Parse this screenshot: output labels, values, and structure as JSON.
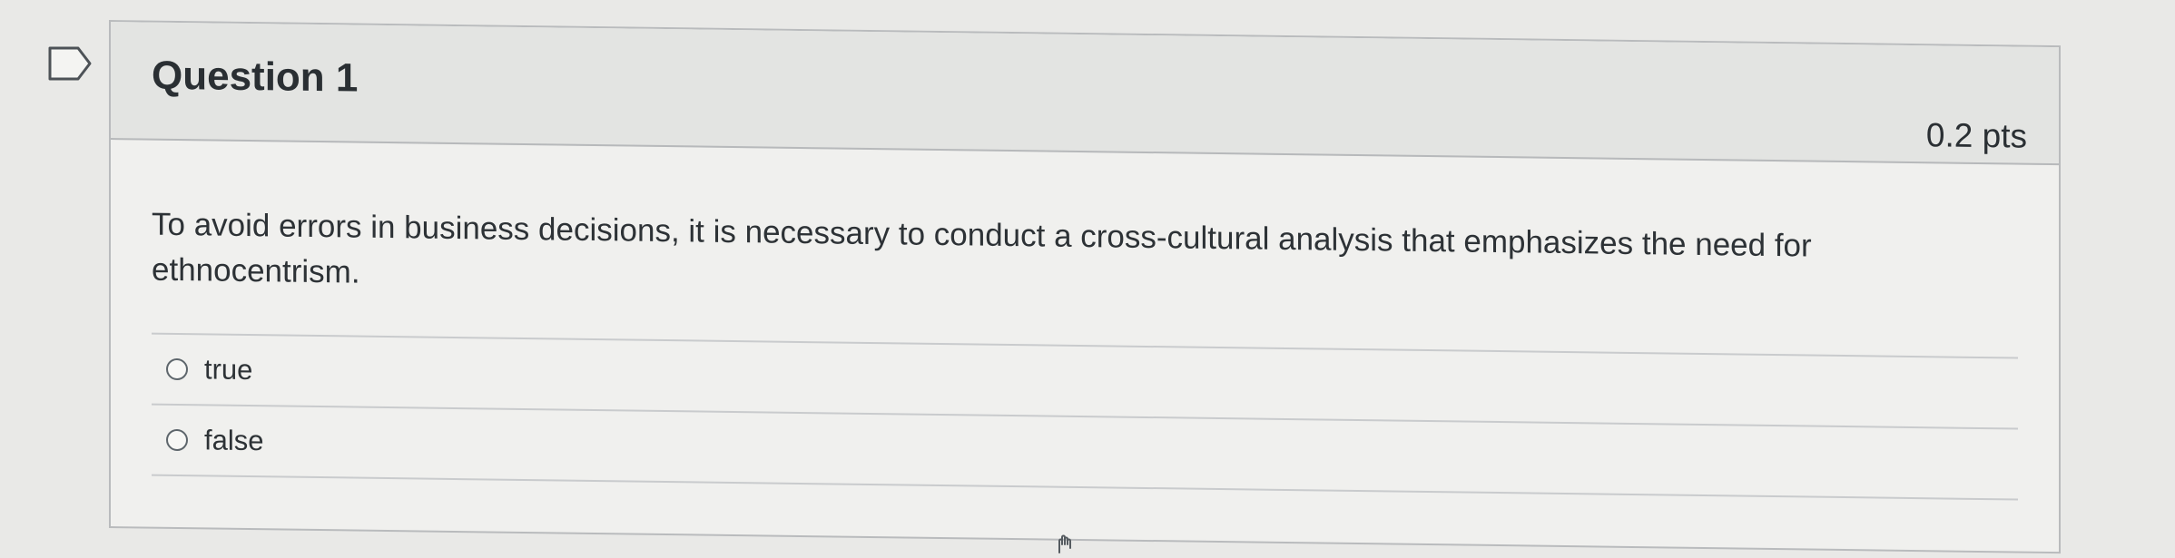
{
  "question": {
    "title": "Question 1",
    "points": "0.2 pts",
    "text": "To avoid errors in business decisions, it is necessary to conduct a cross-cultural analysis that emphasizes the need for ethnocentrism.",
    "answers": [
      {
        "label": "true",
        "selected": false
      },
      {
        "label": "false",
        "selected": false
      }
    ]
  },
  "icons": {
    "flag": "flag-question-icon",
    "pointer": "hand-cursor-icon"
  },
  "colors": {
    "background": "#e9e9e7",
    "card": "#f0f0ee",
    "header": "#e3e4e2",
    "text": "#2d3236"
  }
}
